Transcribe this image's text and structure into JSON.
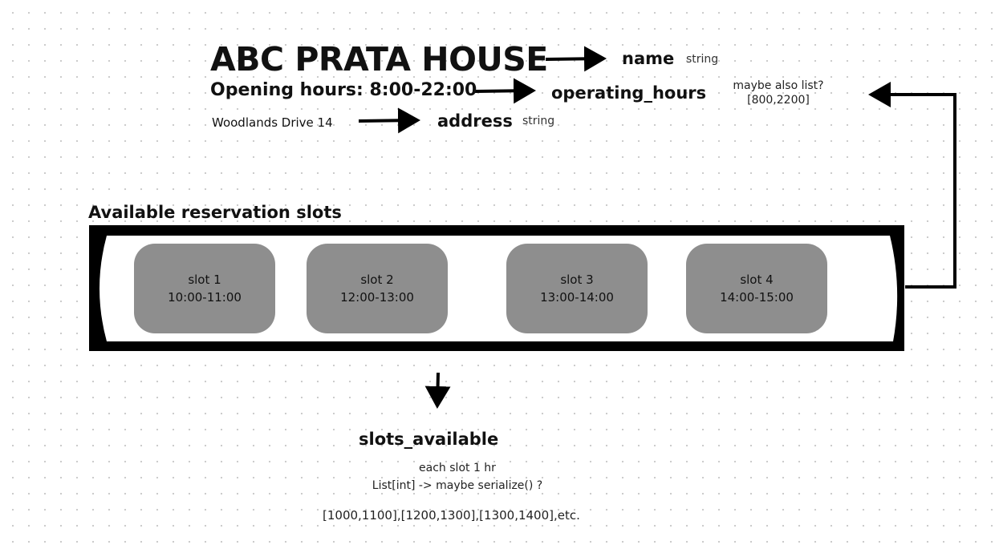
{
  "restaurant": {
    "name": "ABC PRATA HOUSE",
    "opening_hours": "Opening hours: 8:00-22:00",
    "address": "Woodlands Drive 14"
  },
  "fields": {
    "name": {
      "label": "name",
      "type": "string"
    },
    "operating_hours": {
      "label": "operating_hours",
      "note_line1": "maybe also list?",
      "note_line2": "[800,2200]"
    },
    "address": {
      "label": "address",
      "type": "string"
    }
  },
  "reservation": {
    "title": "Available reservation slots",
    "slots": [
      {
        "label": "slot 1",
        "time": "10:00-11:00"
      },
      {
        "label": "slot 2",
        "time": "12:00-13:00"
      },
      {
        "label": "slot 3",
        "time": "13:00-14:00"
      },
      {
        "label": "slot 4",
        "time": "14:00-15:00"
      }
    ]
  },
  "slots_available": {
    "label": "slots_available",
    "note1": "each slot 1 hr",
    "note2": "List[int] -> maybe serialize() ?",
    "example": "[1000,1100],[1200,1300],[1300,1400],etc."
  },
  "colors": {
    "slot_fill": "#8e8e8e",
    "container_border": "#000000"
  }
}
